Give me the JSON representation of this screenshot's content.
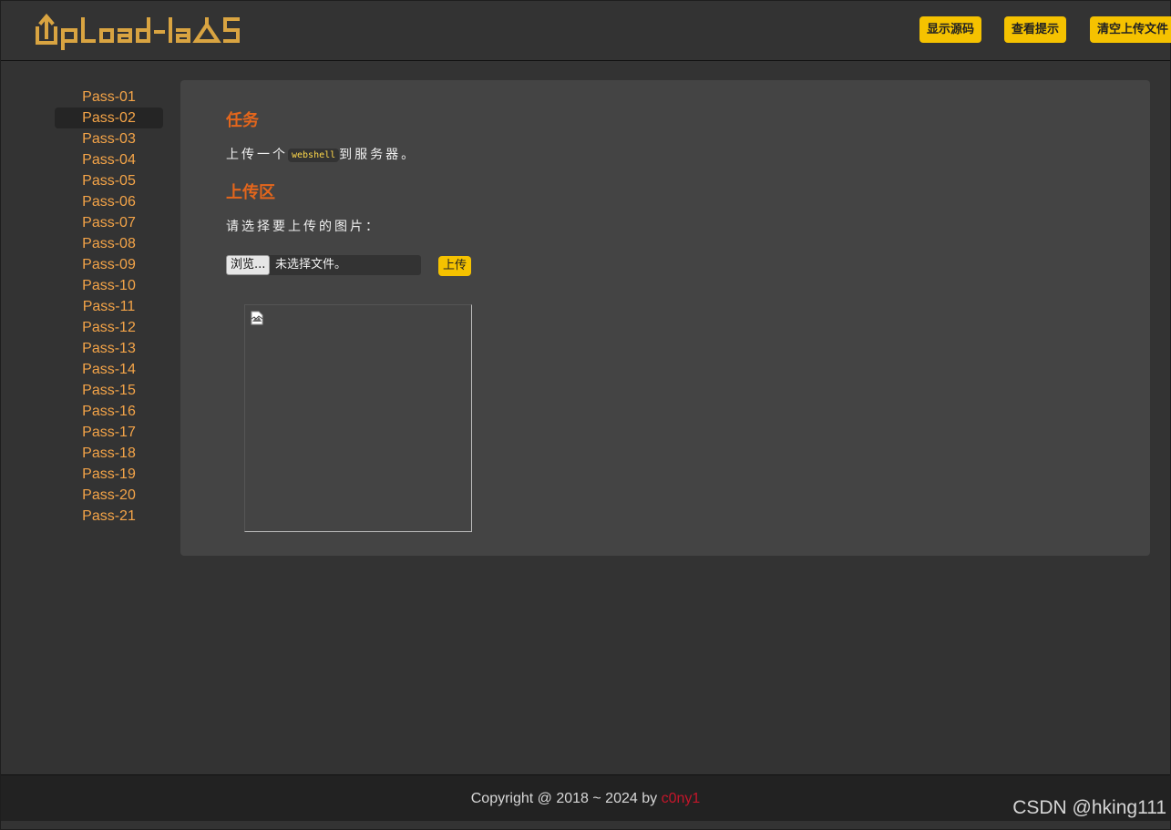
{
  "header": {
    "logo_text": "UpLoad-labs",
    "buttons": {
      "show_source": "显示源码",
      "view_hint": "查看提示",
      "clear_uploads": "清空上传文件"
    }
  },
  "sidebar": {
    "active_index": 1,
    "items": [
      {
        "label": "Pass-01"
      },
      {
        "label": "Pass-02"
      },
      {
        "label": "Pass-03"
      },
      {
        "label": "Pass-04"
      },
      {
        "label": "Pass-05"
      },
      {
        "label": "Pass-06"
      },
      {
        "label": "Pass-07"
      },
      {
        "label": "Pass-08"
      },
      {
        "label": "Pass-09"
      },
      {
        "label": "Pass-10"
      },
      {
        "label": "Pass-11"
      },
      {
        "label": "Pass-12"
      },
      {
        "label": "Pass-13"
      },
      {
        "label": "Pass-14"
      },
      {
        "label": "Pass-15"
      },
      {
        "label": "Pass-16"
      },
      {
        "label": "Pass-17"
      },
      {
        "label": "Pass-18"
      },
      {
        "label": "Pass-19"
      },
      {
        "label": "Pass-20"
      },
      {
        "label": "Pass-21"
      }
    ]
  },
  "task": {
    "title": "任务",
    "text_before": "上传一个",
    "code": "webshell",
    "text_after": "到服务器。"
  },
  "upload": {
    "title": "上传区",
    "prompt": "请选择要上传的图片：",
    "browse_label": "浏览...",
    "file_status": "未选择文件。",
    "submit_label": "上传",
    "preview_icon": "broken-image-icon"
  },
  "footer": {
    "copyright": "Copyright @ 2018 ~ 2024 by ",
    "author": "c0ny1"
  },
  "watermark": "CSDN @hking111",
  "colors": {
    "accent_yellow": "#f5c200",
    "link_orange": "#f4a448",
    "title_orange": "#e4661c",
    "author_red": "#c4162a",
    "background": "#333333",
    "panel": "#444444"
  }
}
